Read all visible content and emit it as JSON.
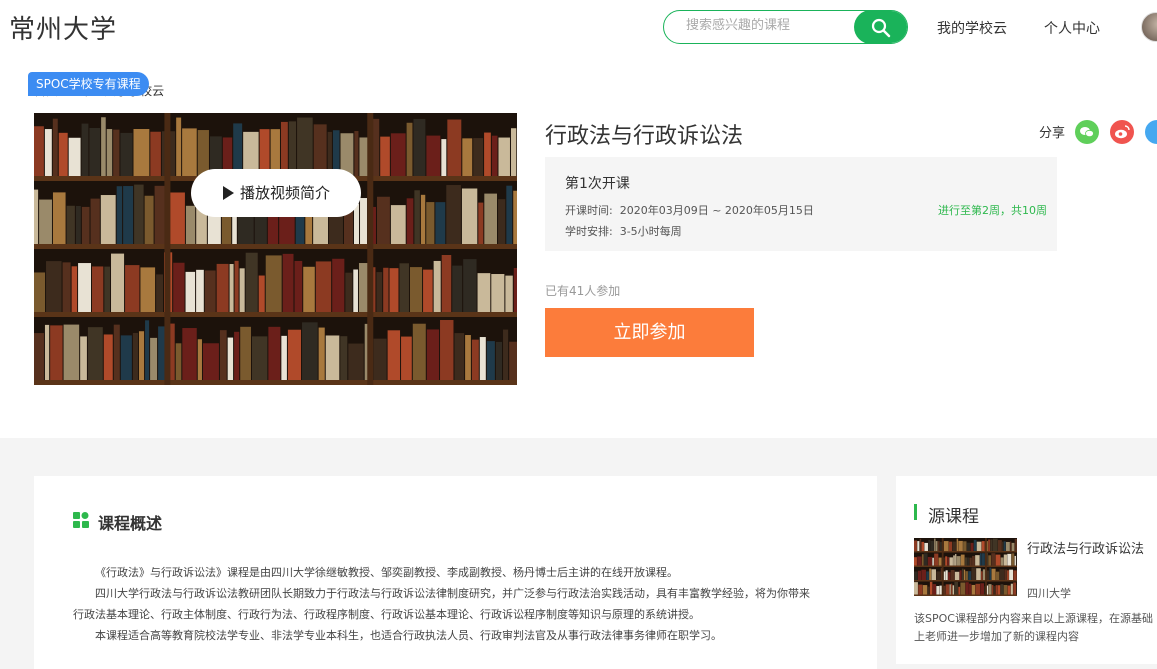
{
  "header": {
    "logo": "常州大学",
    "search_placeholder": "搜索感兴趣的课程",
    "nav": [
      "我的学校云",
      "个人中心"
    ]
  },
  "breadcrumb": [
    "首页",
    "常州大学学校云"
  ],
  "course": {
    "tag": "SPOC学校专有课程",
    "play_label": "播放视频简介",
    "title": "行政法与行政诉讼法",
    "share_label": "分享",
    "term": "第1次开课",
    "time_label": "开课时间:",
    "time_value": "2020年03月09日 ~ 2020年05月15日",
    "hours_label": "学时安排:",
    "hours_value": "3-5小时每周",
    "progress": "进行至第2周，共10周",
    "participants": "已有41人参加",
    "join_label": "立即参加"
  },
  "overview": {
    "title": "课程概述",
    "paragraphs": [
      "《行政法》与行政诉讼法》课程是由四川大学徐继敏教授、邹奕副教授、李成副教授、杨丹博士后主讲的在线开放课程。",
      "四川大学行政法与行政诉讼法教研团队长期致力于行政法与行政诉讼法律制度研究，并广泛参与行政法治实践活动，具有丰富教学经验，将为你带来",
      "行政法基本理论、行政主体制度、行政行为法、行政程序制度、行政诉讼基本理论、行政诉讼程序制度等知识与原理的系统讲授。",
      "本课程适合高等教育院校法学专业、非法学专业本科生，也适合行政执法人员、行政审判法官及从事行政法律事务律师在职学习。"
    ]
  },
  "source": {
    "title": "源课程",
    "course_name": "行政法与行政诉讼法",
    "school": "四川大学",
    "description": "该SPOC课程部分内容来自以上源课程，在源基础上老师进一步增加了新的课程内容"
  },
  "colors": {
    "brand_green": "#1ab35a",
    "join_orange": "#fc7c3b",
    "tag_blue": "#3c8cf2",
    "progress_green": "#2db84d"
  }
}
